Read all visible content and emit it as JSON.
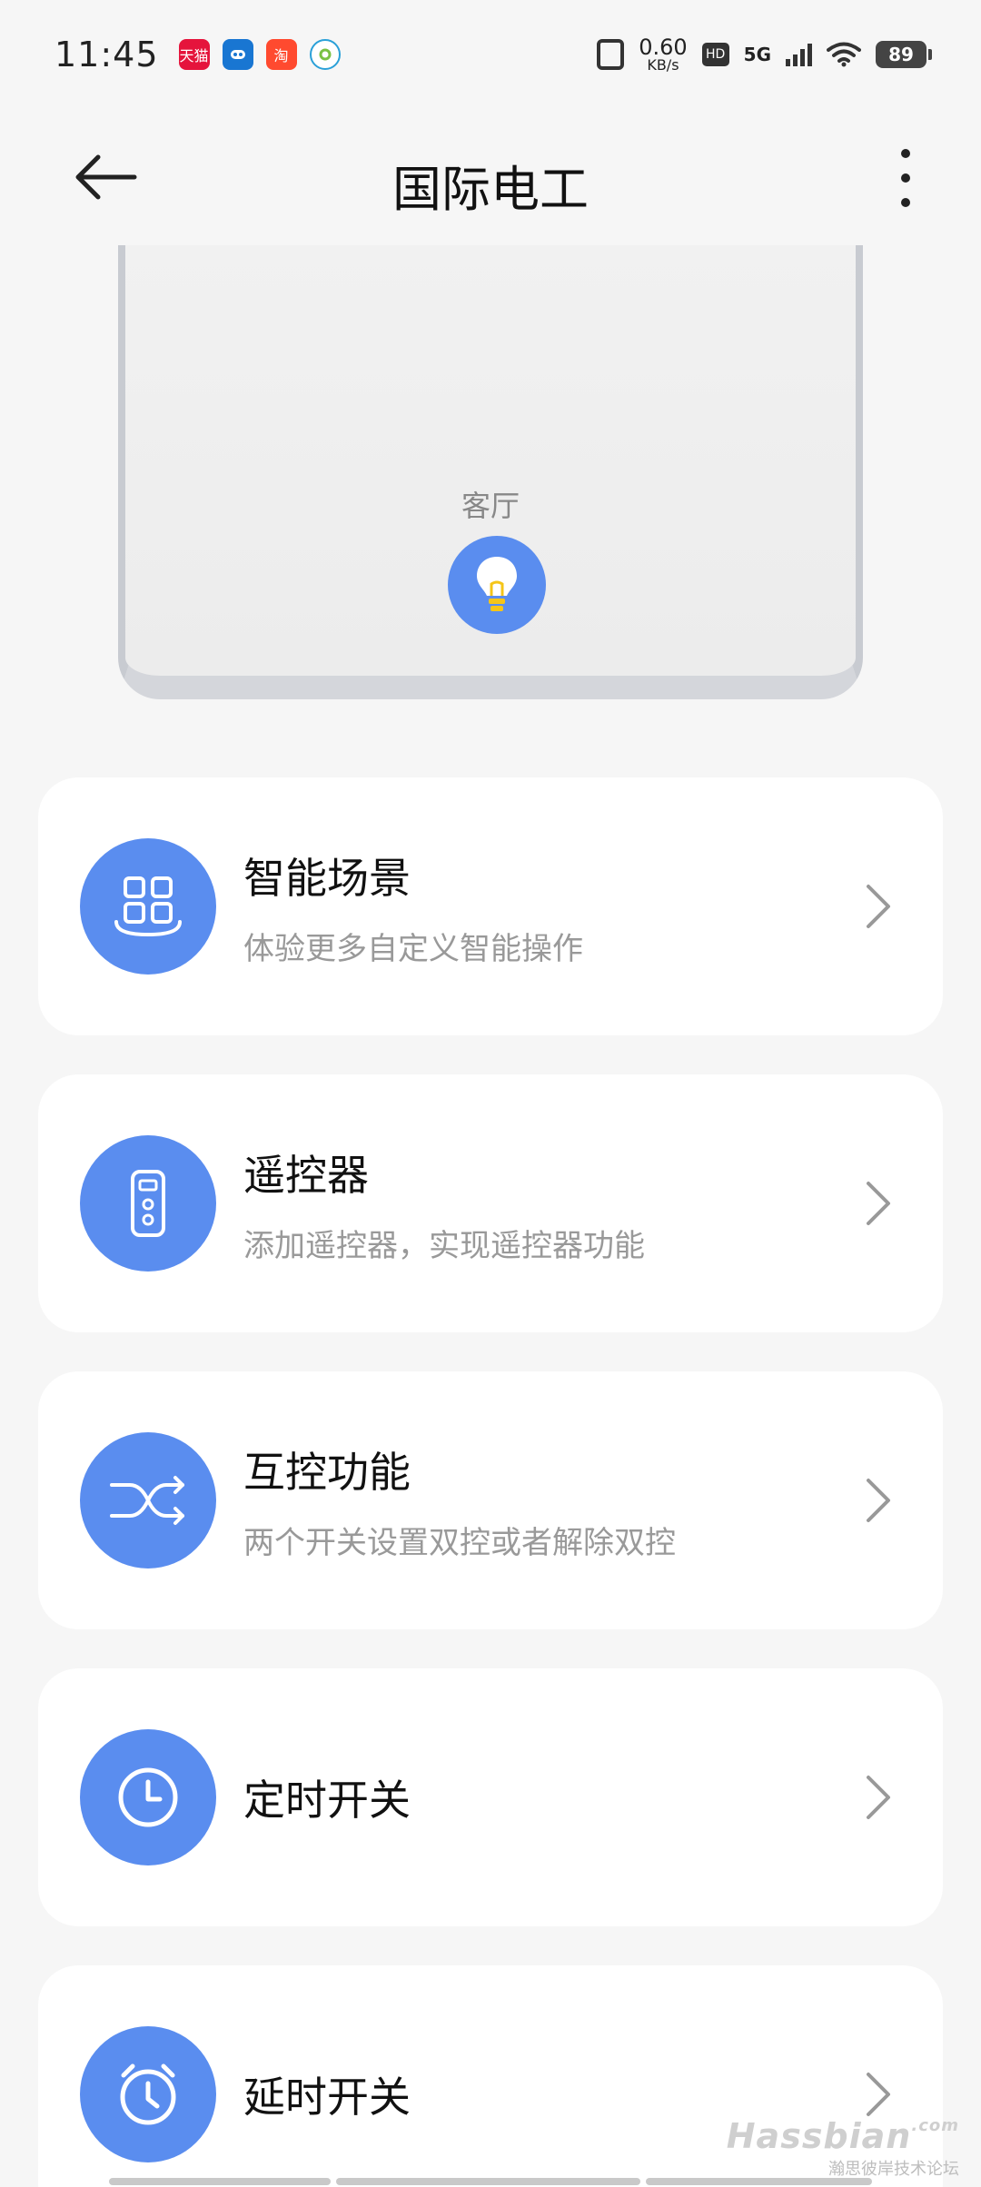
{
  "status_bar": {
    "time": "11:45",
    "notifications": [
      {
        "icon": "tmall-icon",
        "text": "天猫"
      },
      {
        "icon": "app-icon",
        "text": ""
      },
      {
        "icon": "taobao-icon",
        "text": "淘"
      },
      {
        "icon": "camera-app-icon",
        "text": ""
      }
    ],
    "net_speed_value": "0.60",
    "net_speed_unit": "KB/s",
    "hd": "HD",
    "network": "5G",
    "battery": "89"
  },
  "header": {
    "title": "国际电工"
  },
  "preview": {
    "room_label": "客厅"
  },
  "menu": [
    {
      "name": "智能场景",
      "desc": "体验更多自定义智能操作",
      "icon": "smart-scene-icon"
    },
    {
      "name": "遥控器",
      "desc": "添加遥控器，实现遥控器功能",
      "icon": "remote-control-icon"
    },
    {
      "name": "互控功能",
      "desc": "两个开关设置双控或者解除双控",
      "icon": "mutual-control-icon"
    },
    {
      "name": "定时开关",
      "desc": "",
      "icon": "clock-icon"
    },
    {
      "name": "延时开关",
      "desc": "",
      "icon": "alarm-timer-icon"
    }
  ],
  "watermark": {
    "brand": "Hassbian",
    "domain": ".com",
    "sub": "瀚思彼岸技术论坛"
  },
  "colors": {
    "accent": "#5a8def",
    "background": "#f6f6f6",
    "card": "#ffffff"
  }
}
